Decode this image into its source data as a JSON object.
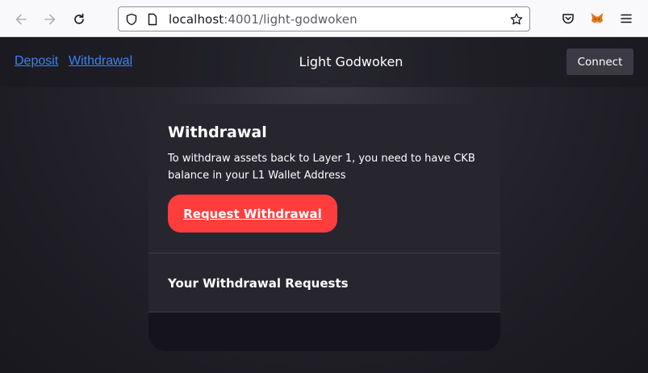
{
  "browser": {
    "url_host": "localhost",
    "url_rest": ":4001/light-godwoken",
    "icons": [
      "back-icon",
      "forward-icon",
      "reload-icon",
      "shield-icon",
      "page-icon",
      "bookmark-star-icon",
      "pocket-icon",
      "metamask-fox-icon",
      "menu-icon"
    ]
  },
  "header": {
    "deposit_link": "Deposit",
    "withdrawal_link": "Withdrawal",
    "title": "Light Godwoken",
    "connect_label": "Connect"
  },
  "card": {
    "title": "Withdrawal",
    "description": "To withdraw assets back to Layer 1, you need to have CKB balance in your L1 Wallet Address",
    "request_button": "Request Withdrawal",
    "requests_title": "Your Withdrawal Requests"
  },
  "colors": {
    "accent_red": "#ff3d3d",
    "link_blue": "#3b82f6",
    "card_bg": "#27262f"
  }
}
